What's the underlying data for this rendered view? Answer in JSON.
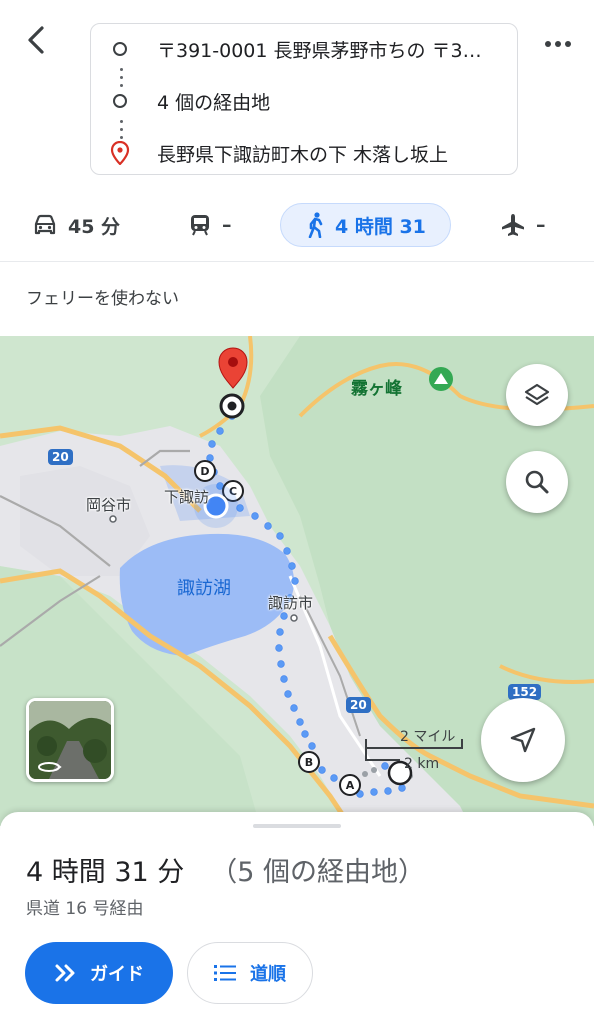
{
  "route": {
    "origin": "〒391-0001 長野県茅野市ちの 〒3…",
    "waypoints": "4 個の経由地",
    "destination": "長野県下諏訪町木の下 木落し坂上"
  },
  "modes": [
    {
      "name": "car-icon",
      "label": "45 分"
    },
    {
      "name": "train-icon",
      "label": "–"
    },
    {
      "name": "walk-icon",
      "label": "4 時間 31",
      "active": true
    },
    {
      "name": "flight-icon",
      "label": "–"
    }
  ],
  "options": {
    "avoid_ferries": "フェリーを使わない"
  },
  "map": {
    "labels": {
      "kirigamine": "霧ヶ峰",
      "okaya": "岡谷市",
      "shimosuwa": "下諏訪",
      "suwako": "諏訪湖",
      "suwa": "諏訪市"
    },
    "road_shields": [
      "20",
      "20",
      "152"
    ],
    "waypoint_markers": [
      "A",
      "B",
      "C",
      "D"
    ],
    "scale": {
      "miles": "2 マイル",
      "km": "2 km"
    },
    "colors": {
      "route": "#5b9af5",
      "lake": "#9cbcf6",
      "land": "#cfe6cf",
      "urban": "#e8e8ec",
      "pin": "#d93025"
    }
  },
  "summary": {
    "duration": "4 時間 31 分",
    "via_count": "（5 個の経由地）",
    "via_road": "県道 16 号経由"
  },
  "actions": {
    "guide": "ガイド",
    "steps": "道順"
  }
}
